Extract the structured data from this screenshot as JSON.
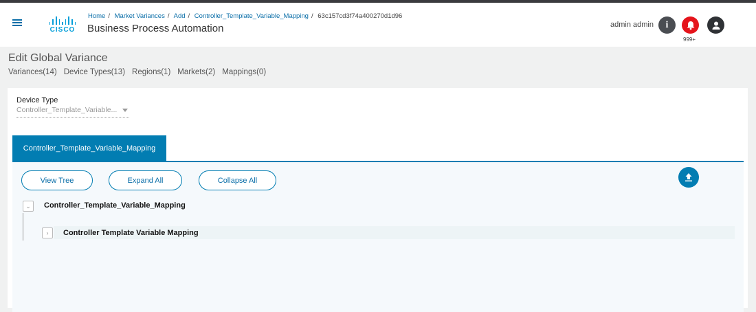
{
  "header": {
    "breadcrumb": [
      "Home",
      "Market Variances",
      "Add",
      "Controller_Template_Variable_Mapping"
    ],
    "breadcrumb_current": "63c157cd3f74a400270d1d96",
    "logo_text": "CISCO",
    "app_title": "Business Process Automation",
    "user_name": "admin admin",
    "notification_count": "999+",
    "colors": {
      "accent": "#027db2",
      "alert": "#e5141b"
    }
  },
  "page": {
    "title": "Edit Global Variance",
    "stats": [
      "Variances(14)",
      "Device Types(13)",
      "Regions(1)",
      "Markets(2)",
      "Mappings(0)"
    ]
  },
  "form": {
    "device_type_label": "Device Type",
    "device_type_value": "Controller_Template_Variable..."
  },
  "tabs": [
    {
      "label": "Controller_Template_Variable_Mapping",
      "active": true
    }
  ],
  "toolbar": {
    "view_tree": "View Tree",
    "expand_all": "Expand All",
    "collapse_all": "Collapse All"
  },
  "tree": {
    "root": "Controller_Template_Variable_Mapping",
    "children": [
      "Controller Template Variable Mapping"
    ]
  }
}
